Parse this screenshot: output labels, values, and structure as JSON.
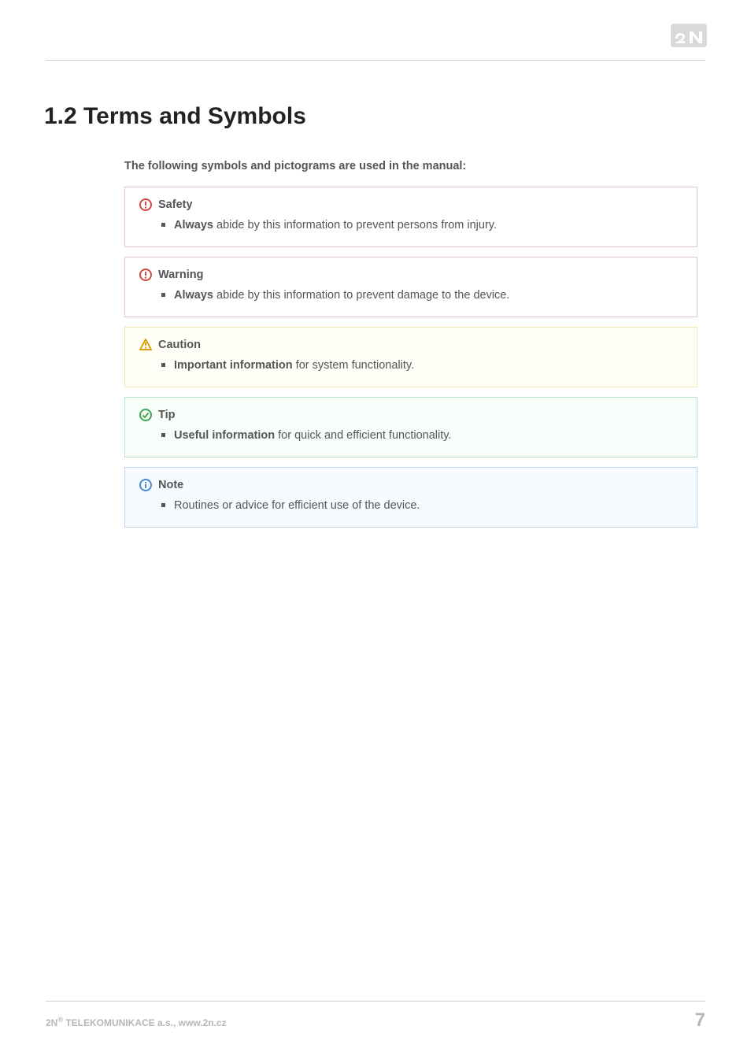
{
  "brand": {
    "name": "2N"
  },
  "heading": "1.2 Terms and Symbols",
  "intro": "The following symbols and pictograms are used in the manual:",
  "callouts": {
    "safety": {
      "icon": "alert-circle-icon",
      "title": "Safety",
      "bold": "Always",
      "rest": "  abide by this information to prevent persons from injury."
    },
    "warning": {
      "icon": "alert-circle-icon",
      "title": "Warning",
      "bold": "Always",
      "rest": " abide by this information to prevent damage to the device."
    },
    "caution": {
      "icon": "warning-triangle-icon",
      "title": "Caution",
      "bold": "Important information",
      "rest": " for system functionality."
    },
    "tip": {
      "icon": "check-circle-icon",
      "title": "Tip",
      "bold": "Useful information",
      "rest": " for quick and efficient functionality."
    },
    "note": {
      "icon": "info-circle-icon",
      "title": "Note",
      "text": "Routines or advice for efficient use of the device."
    }
  },
  "footer": {
    "company_prefix": "2N",
    "company_sup": "®",
    "company_rest": " TELEKOMUNIKACE a.s., www.2n.cz",
    "page_number": "7"
  },
  "colors": {
    "red_icon": "#d24a43",
    "yellow_icon": "#d9a10b",
    "green_icon": "#3fa756",
    "blue_icon": "#4a8ac9"
  }
}
